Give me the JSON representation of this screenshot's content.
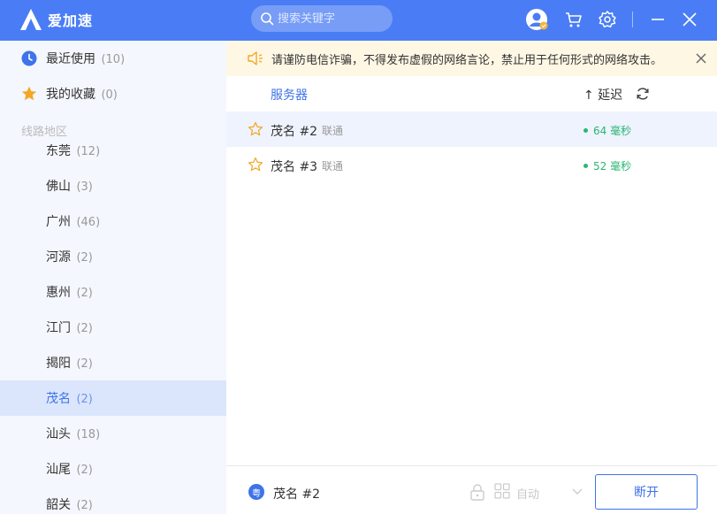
{
  "app": {
    "name": "爱加速"
  },
  "search": {
    "placeholder": "搜索关键字"
  },
  "sidebar": {
    "recent": {
      "label": "最近使用",
      "count": "(10)"
    },
    "favorites": {
      "label": "我的收藏",
      "count": "(0)"
    },
    "section_label": "线路地区",
    "regions": [
      {
        "label": "东莞",
        "count": "(12)"
      },
      {
        "label": "佛山",
        "count": "(3)"
      },
      {
        "label": "广州",
        "count": "(46)"
      },
      {
        "label": "河源",
        "count": "(2)"
      },
      {
        "label": "惠州",
        "count": "(2)"
      },
      {
        "label": "江门",
        "count": "(2)"
      },
      {
        "label": "揭阳",
        "count": "(2)"
      },
      {
        "label": "茂名",
        "count": "(2)"
      },
      {
        "label": "汕头",
        "count": "(18)"
      },
      {
        "label": "汕尾",
        "count": "(2)"
      },
      {
        "label": "韶关",
        "count": "(2)"
      }
    ],
    "active_region": "茂名"
  },
  "notice": {
    "text": "请谨防电信诈骗，不得发布虚假的网络言论，禁止用于任何形式的网络攻击。"
  },
  "table": {
    "col_server": "服务器",
    "col_latency": "↑ 延迟",
    "rows": [
      {
        "name": "茂名 #2",
        "isp": "联通",
        "latency": "64 毫秒"
      },
      {
        "name": "茂名 #3",
        "isp": "联通",
        "latency": "52 毫秒"
      }
    ]
  },
  "bottom": {
    "badge": "粤",
    "current_server": "茂名 #2",
    "mode": "自动",
    "disconnect_label": "断开"
  },
  "colors": {
    "brand": "#4a7df5",
    "accent": "#3e73e9",
    "good": "#2bb673",
    "notice_bg": "#fef7e4"
  }
}
